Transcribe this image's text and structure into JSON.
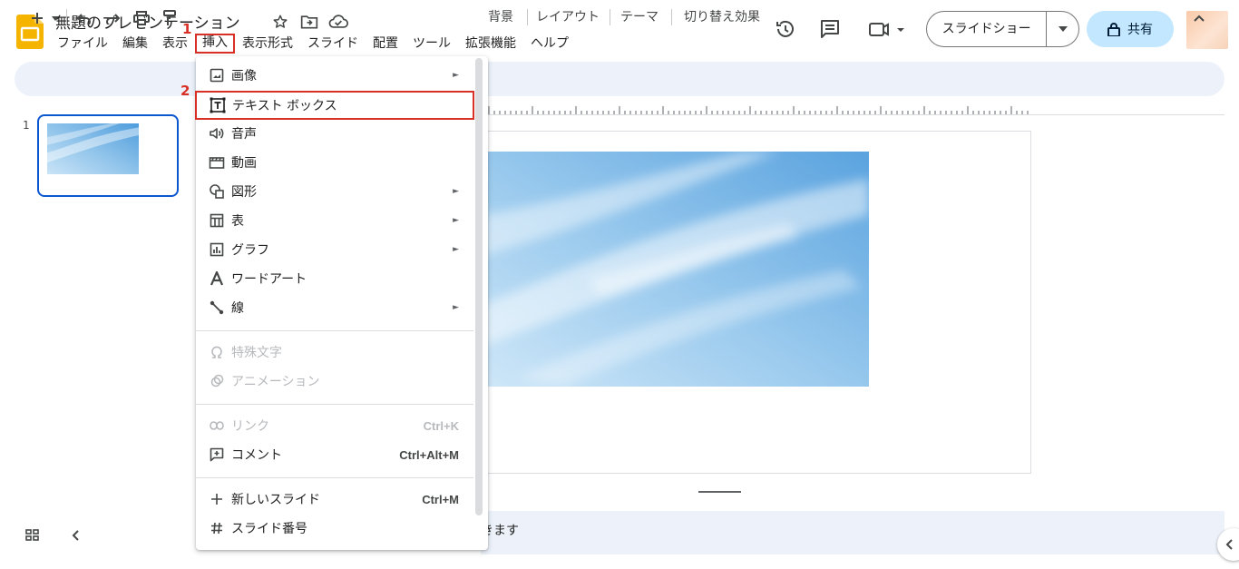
{
  "header": {
    "title": "無題のプレゼンテーション",
    "menu": [
      "ファイル",
      "編集",
      "表示",
      "挿入",
      "表示形式",
      "スライド",
      "配置",
      "ツール",
      "拡張機能",
      "ヘルプ"
    ],
    "slideshow_label": "スライドショー",
    "share_label": "共有"
  },
  "steps": {
    "one": "1",
    "two": "2"
  },
  "toolbar": {
    "background_label": "背景",
    "layout_label": "レイアウト",
    "theme_label": "テーマ",
    "transition_label": "切り替え効果"
  },
  "filmstrip": {
    "slide_number": "1"
  },
  "notes": {
    "placeholder_fragment": "きます"
  },
  "insert_menu": {
    "items": [
      {
        "label": "画像",
        "icon": "image-icon",
        "submenu": true
      },
      {
        "label": "テキスト ボックス",
        "icon": "text-box-icon",
        "submenu": false
      },
      {
        "label": "音声",
        "icon": "audio-icon",
        "submenu": false
      },
      {
        "label": "動画",
        "icon": "video-icon",
        "submenu": false
      },
      {
        "label": "図形",
        "icon": "shapes-icon",
        "submenu": true
      },
      {
        "label": "表",
        "icon": "table-icon",
        "submenu": true
      },
      {
        "label": "グラフ",
        "icon": "chart-icon",
        "submenu": true
      },
      {
        "label": "ワードアート",
        "icon": "word-art-icon",
        "submenu": false
      },
      {
        "label": "線",
        "icon": "line-icon",
        "submenu": true
      },
      {
        "label": "特殊文字",
        "icon": "omega-icon",
        "submenu": false,
        "disabled": true
      },
      {
        "label": "アニメーション",
        "icon": "animation-icon",
        "submenu": false,
        "disabled": true
      },
      {
        "label": "リンク",
        "icon": "link-icon",
        "shortcut": "Ctrl+K",
        "disabled": true
      },
      {
        "label": "コメント",
        "icon": "comment-add-icon",
        "shortcut": "Ctrl+Alt+M"
      },
      {
        "label": "新しいスライド",
        "icon": "plus-icon",
        "shortcut": "Ctrl+M"
      },
      {
        "label": "スライド番号",
        "icon": "hash-icon"
      }
    ],
    "arrow_glyph": "►"
  },
  "colors": {
    "accent_red": "#d93025",
    "selection_blue": "#0b57d0",
    "share_bg": "#c2e7ff",
    "toolbar_bg": "#edf2fa"
  }
}
